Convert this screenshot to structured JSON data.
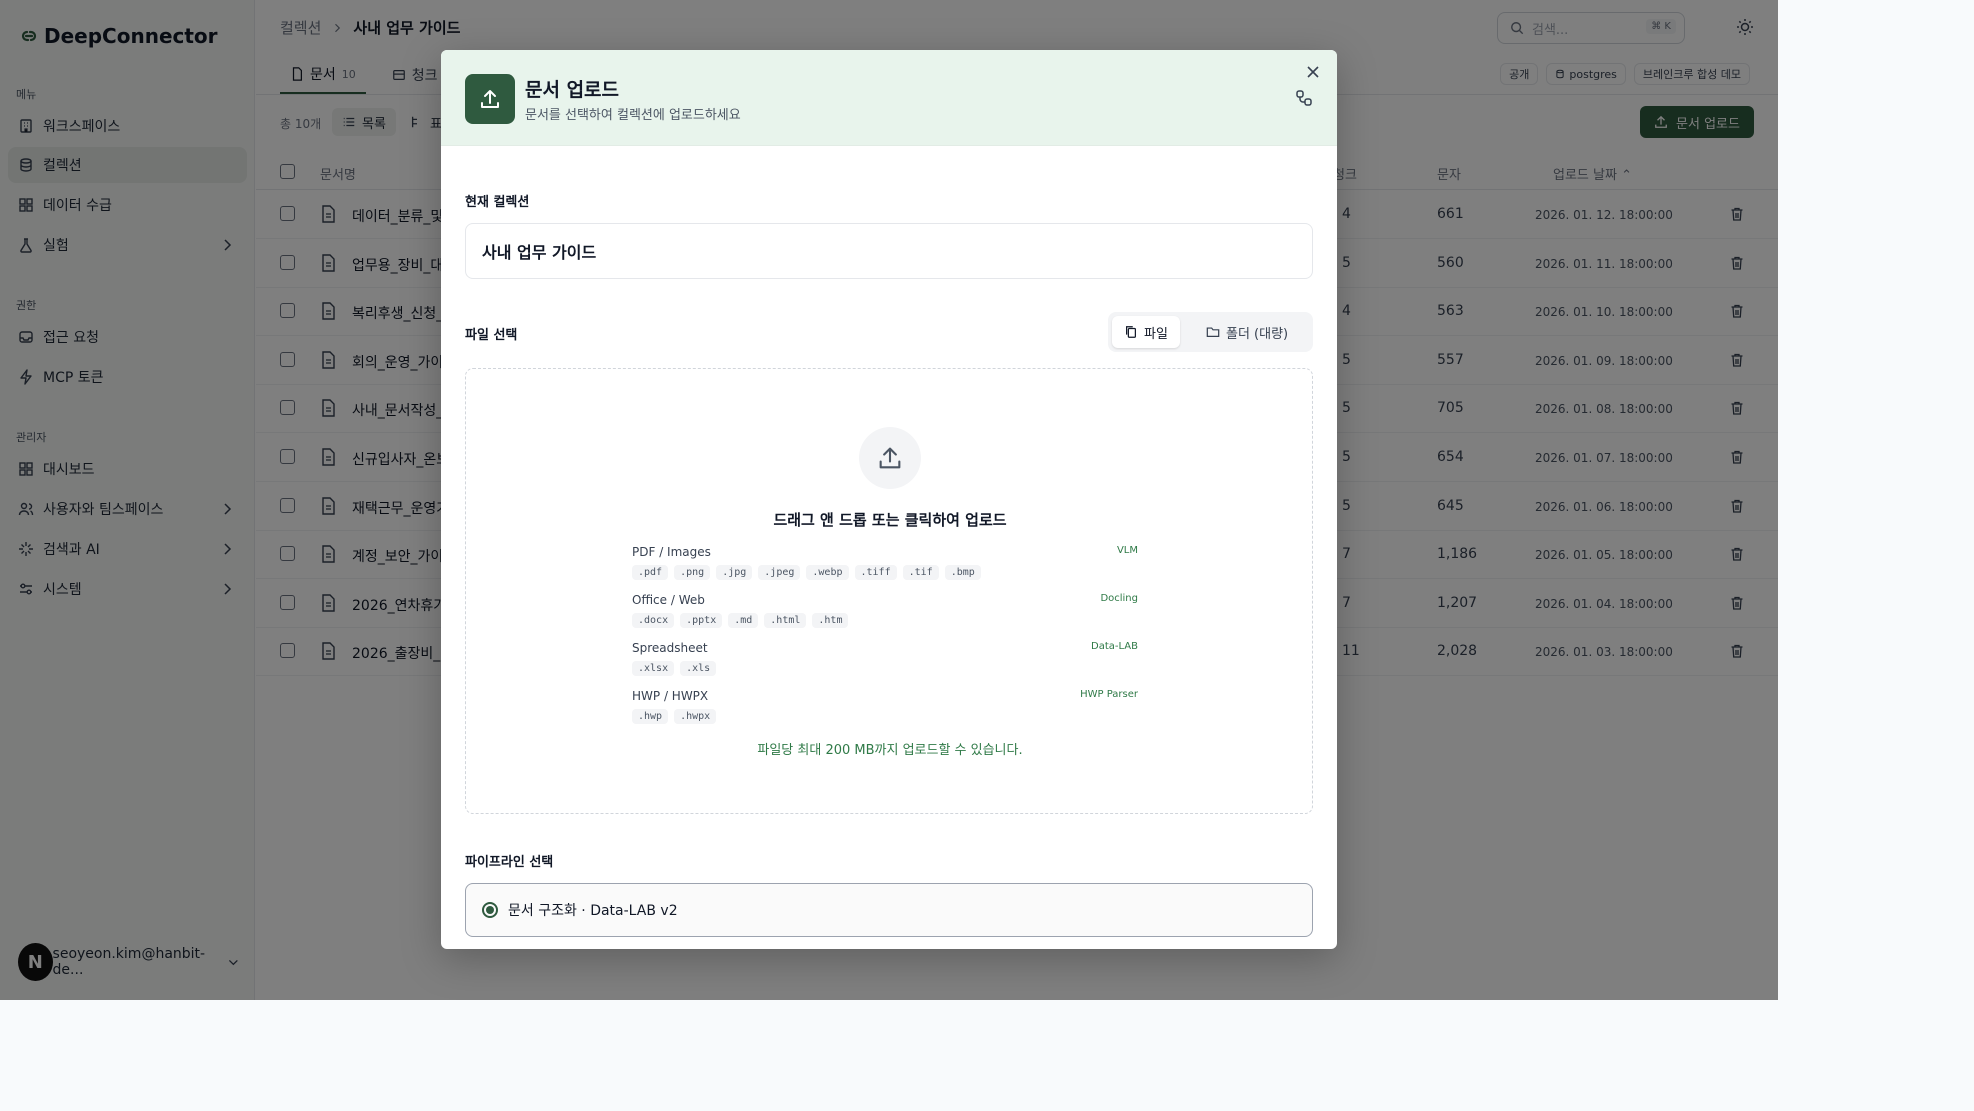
{
  "sidebar": {
    "logo": "DeepConnector",
    "sections": {
      "menu": "메뉴",
      "perm": "권한",
      "admin": "관리자"
    },
    "items": [
      {
        "label": "워크스페이스",
        "icon": "building-icon"
      },
      {
        "label": "컬렉션",
        "icon": "database-icon"
      },
      {
        "label": "데이터 수급",
        "icon": "grid-icon"
      },
      {
        "label": "실험",
        "icon": "flask-icon"
      },
      {
        "label": "접근 요청",
        "icon": "inbox-icon"
      },
      {
        "label": "MCP 토큰",
        "icon": "bolt-icon"
      },
      {
        "label": "대시보드",
        "icon": "dashboard-icon"
      },
      {
        "label": "사용자와 팀스페이스",
        "icon": "users-icon"
      },
      {
        "label": "검색과 AI",
        "icon": "sparkle-icon"
      },
      {
        "label": "시스템",
        "icon": "sliders-icon"
      }
    ],
    "user": {
      "initial": "N",
      "email": "seoyeon.kim@hanbit-de..."
    }
  },
  "header": {
    "breadcrumb": [
      "컬렉션",
      "사내 업무 가이드"
    ],
    "search_placeholder": "검색...",
    "search_shortcut": "⌘ K"
  },
  "tabs": [
    {
      "label": "문서",
      "count": "10"
    },
    {
      "label": "청크",
      "count": ""
    }
  ],
  "chips": [
    "공개",
    "postgres",
    "브레인크루 합성 데모"
  ],
  "toolbar": {
    "total": "총 10개",
    "view_list": "목록",
    "view_other": "표",
    "upload": "문서 업로드"
  },
  "table": {
    "columns": {
      "name": "문서명",
      "chunks": "청크",
      "chars": "문자",
      "date": "업로드 날짜"
    },
    "rows": [
      {
        "name": "데이터_분류_및",
        "chunks": "4",
        "chars": "661",
        "date": "2026. 01. 12. 18:00:00"
      },
      {
        "name": "업무용_장비_대",
        "chunks": "5",
        "chars": "560",
        "date": "2026. 01. 11. 18:00:00"
      },
      {
        "name": "복리후생_신청_",
        "chunks": "4",
        "chars": "563",
        "date": "2026. 01. 10. 18:00:00"
      },
      {
        "name": "회의_운영_가이",
        "chunks": "5",
        "chars": "557",
        "date": "2026. 01. 09. 18:00:00"
      },
      {
        "name": "사내_문서작성_",
        "chunks": "5",
        "chars": "705",
        "date": "2026. 01. 08. 18:00:00"
      },
      {
        "name": "신규입사자_온보",
        "chunks": "5",
        "chars": "654",
        "date": "2026. 01. 07. 18:00:00"
      },
      {
        "name": "재택근무_운영가",
        "chunks": "5",
        "chars": "645",
        "date": "2026. 01. 06. 18:00:00"
      },
      {
        "name": "계정_보안_가이",
        "chunks": "7",
        "chars": "1,186",
        "date": "2026. 01. 05. 18:00:00"
      },
      {
        "name": "2026_연차휴가",
        "chunks": "7",
        "chars": "1,207",
        "date": "2026. 01. 04. 18:00:00"
      },
      {
        "name": "2026_출장비_",
        "chunks": "11",
        "chars": "2,028",
        "date": "2026. 01. 03. 18:00:00"
      }
    ]
  },
  "modal": {
    "title": "문서 업로드",
    "subtitle": "문서를 선택하여 컬렉션에 업로드하세요",
    "current_collection_label": "현재 컬렉션",
    "current_collection": "사내 업무 가이드",
    "file_select_label": "파일 선택",
    "mode_file": "파일",
    "mode_folder": "폴더 (대량)",
    "drop_title": "드래그 앤 드롭 또는 클릭하여 업로드",
    "file_types": [
      {
        "name": "PDF / Images",
        "tool": "VLM",
        "exts": [
          ".pdf",
          ".png",
          ".jpg",
          ".jpeg",
          ".webp",
          ".tiff",
          ".tif",
          ".bmp"
        ]
      },
      {
        "name": "Office / Web",
        "tool": "Docling",
        "exts": [
          ".docx",
          ".pptx",
          ".md",
          ".html",
          ".htm"
        ]
      },
      {
        "name": "Spreadsheet",
        "tool": "Data-LAB",
        "exts": [
          ".xlsx",
          ".xls"
        ]
      },
      {
        "name": "HWP / HWPX",
        "tool": "HWP Parser",
        "exts": [
          ".hwp",
          ".hwpx"
        ]
      }
    ],
    "limit_text": "파일당 최대 200 MB까지 업로드할 수 있습니다.",
    "pipeline_label": "파이프라인 선택",
    "pipeline_option": "문서 구조화 · Data-LAB v2"
  },
  "colors": {
    "brand": "#2f5a3f",
    "accent_text": "#2f7a47",
    "overlay": "rgba(0,0,0,0.5)"
  }
}
